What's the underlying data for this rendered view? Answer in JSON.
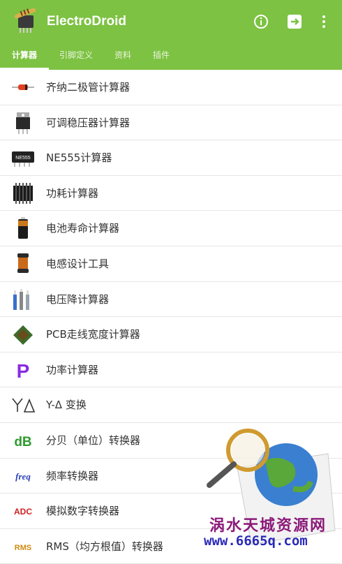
{
  "app": {
    "title": "ElectroDroid"
  },
  "actions": {
    "info_icon": "info-icon",
    "exit_icon": "exit-icon",
    "more_icon": "more-vert-icon"
  },
  "tabs": [
    {
      "label": "计算器",
      "active": true
    },
    {
      "label": "引脚定义",
      "active": false
    },
    {
      "label": "资料",
      "active": false
    },
    {
      "label": "插件",
      "active": false
    }
  ],
  "list": [
    {
      "label": "齐纳二极管计算器",
      "icon": "zener-diode-icon"
    },
    {
      "label": "可调稳压器计算器",
      "icon": "voltage-regulator-icon"
    },
    {
      "label": "NE555计算器",
      "icon": "ne555-chip-icon",
      "icon_text": "NE555"
    },
    {
      "label": "功耗计算器",
      "icon": "heatsink-icon"
    },
    {
      "label": "电池寿命计算器",
      "icon": "battery-icon"
    },
    {
      "label": "电感设计工具",
      "icon": "inductor-icon"
    },
    {
      "label": "电压降计算器",
      "icon": "wires-icon"
    },
    {
      "label": "PCB走线宽度计算器",
      "icon": "pcb-icon"
    },
    {
      "label": "功率计算器",
      "icon": "power-p-icon",
      "icon_text": "P"
    },
    {
      "label": "Y-Δ 变换",
      "icon": "y-delta-icon"
    },
    {
      "label": "分贝（单位）转换器",
      "icon": "db-icon",
      "icon_text": "dB"
    },
    {
      "label": "频率转换器",
      "icon": "freq-icon",
      "icon_text": "freq"
    },
    {
      "label": "模拟数字转换器",
      "icon": "adc-icon",
      "icon_text": "ADC"
    },
    {
      "label": "RMS（均方根值）转换器",
      "icon": "rms-icon",
      "icon_text": "RMS"
    }
  ],
  "watermark": {
    "cn": "涡水天城资源网",
    "url": "www.6665q.com"
  },
  "colors": {
    "primary": "#7dc242",
    "text": "#333333",
    "divider": "#e6e6e6"
  }
}
